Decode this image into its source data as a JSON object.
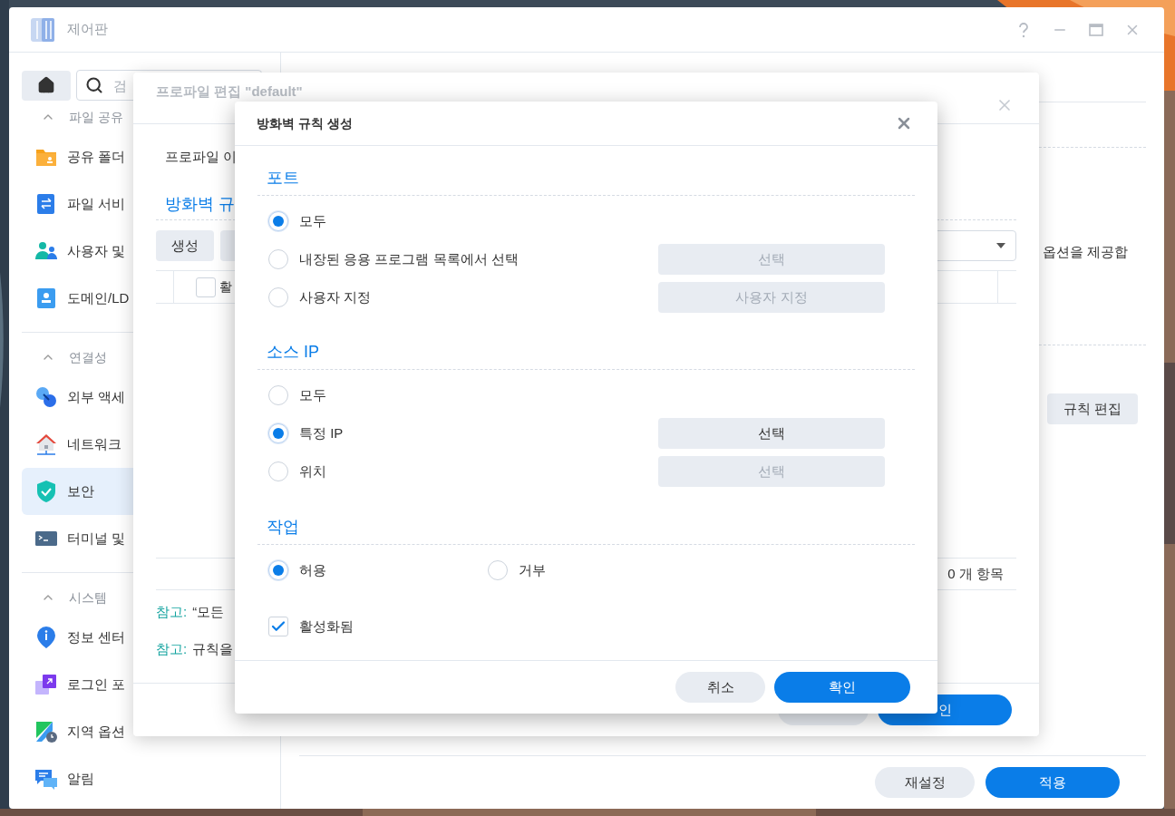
{
  "window": {
    "title": "제어판"
  },
  "sidebar": {
    "search": {
      "placeholder": "검"
    },
    "groups": [
      {
        "label": "파일 공유",
        "expanded": true,
        "items": [
          {
            "label": "공유 폴더",
            "selected": false
          },
          {
            "label": "파일 서비",
            "selected": false
          },
          {
            "label": "사용자 및",
            "selected": false
          },
          {
            "label": "도메인/LD",
            "selected": false
          }
        ]
      },
      {
        "label": "연결성",
        "expanded": true,
        "items": [
          {
            "label": "외부 액세",
            "selected": false
          },
          {
            "label": "네트워크",
            "selected": false
          },
          {
            "label": "보안",
            "selected": true
          },
          {
            "label": "터미널 및",
            "selected": false
          }
        ]
      },
      {
        "label": "시스템",
        "expanded": true,
        "items": [
          {
            "label": "정보 센터",
            "selected": false
          },
          {
            "label": "로그인 포",
            "selected": false
          },
          {
            "label": "지역 옵션",
            "selected": false
          },
          {
            "label": "알림",
            "selected": false
          }
        ]
      }
    ]
  },
  "main": {
    "description": "옵션을 제공합",
    "edit_rules_button": "규칙 편집",
    "footer_buttons": [
      {
        "label": "재설정",
        "kind": "secondary"
      },
      {
        "label": "적용",
        "kind": "primary"
      }
    ]
  },
  "profile_dialog": {
    "title": "프로파일 편집 \"default\"",
    "name_label": "프로파일 이",
    "section_title": "방화벽 규",
    "create_button": "생성",
    "table_header": {
      "label": "활",
      "checked": false
    },
    "item_count": "0 개 항목",
    "notes": [
      {
        "label": "참고:",
        "text": "“모든"
      },
      {
        "label": "참고:",
        "text": "규칙을"
      }
    ],
    "confirm_button": "인"
  },
  "rule_dialog": {
    "title": "방화벽 규칙 생성",
    "sections": [
      {
        "title": "포트",
        "options": [
          {
            "label": "모두",
            "selected": true
          },
          {
            "label": "내장된 응용 프로그램 목록에서 선택",
            "selected": false,
            "button": {
              "label": "선택",
              "disabled": true
            }
          },
          {
            "label": "사용자 지정",
            "selected": false,
            "button": {
              "label": "사용자 지정",
              "disabled": true
            }
          }
        ]
      },
      {
        "title": "소스 IP",
        "options": [
          {
            "label": "모두",
            "selected": false
          },
          {
            "label": "특정 IP",
            "selected": true,
            "button": {
              "label": "선택",
              "disabled": false
            }
          },
          {
            "label": "위치",
            "selected": false,
            "button": {
              "label": "선택",
              "disabled": true
            }
          }
        ]
      }
    ],
    "action": {
      "title": "작업",
      "options": [
        {
          "label": "허용",
          "selected": true
        },
        {
          "label": "거부",
          "selected": false
        }
      ]
    },
    "enabled": {
      "label": "활성화됨",
      "checked": true
    },
    "buttons": {
      "cancel": "취소",
      "ok": "확인"
    }
  }
}
